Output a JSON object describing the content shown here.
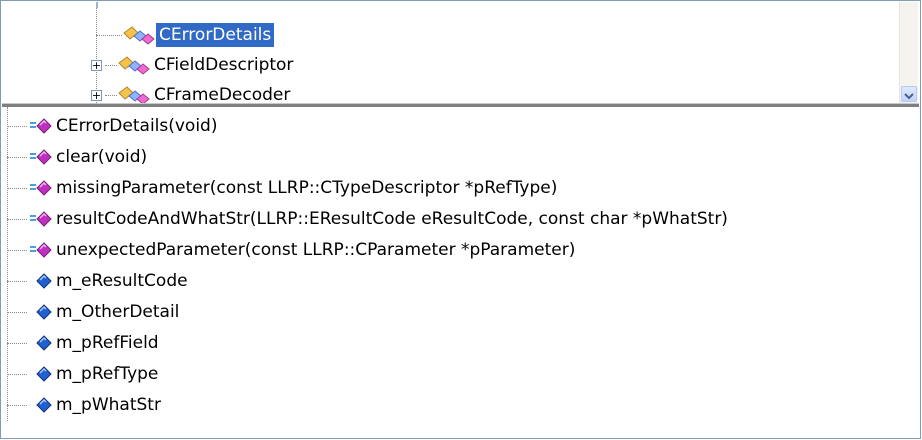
{
  "class_tree": {
    "items": [
      {
        "label": "CErrorDetails",
        "selected": true,
        "expander": ""
      },
      {
        "label": "CFieldDescriptor",
        "selected": false,
        "expander": "+"
      },
      {
        "label": "CFrameDecoder",
        "selected": false,
        "expander": "+"
      }
    ]
  },
  "members": {
    "methods": [
      "CErrorDetails(void)",
      "clear(void)",
      "missingParameter(const LLRP::CTypeDescriptor *pRefType)",
      "resultCodeAndWhatStr(LLRP::EResultCode eResultCode, const char *pWhatStr)",
      "unexpectedParameter(const LLRP::CParameter *pParameter)"
    ],
    "fields": [
      "m_eResultCode",
      "m_OtherDetail",
      "m_pRefField",
      "m_pRefType",
      "m_pWhatStr"
    ]
  },
  "colors": {
    "selection": "#316ac5",
    "method_icon": "#c030c0",
    "field_icon": "#2060d0",
    "class_icon": "#e8a820"
  },
  "icons": {
    "class": "class-icon",
    "method": "method-icon",
    "field": "field-icon",
    "scroll_down": "chevron-down-icon"
  }
}
